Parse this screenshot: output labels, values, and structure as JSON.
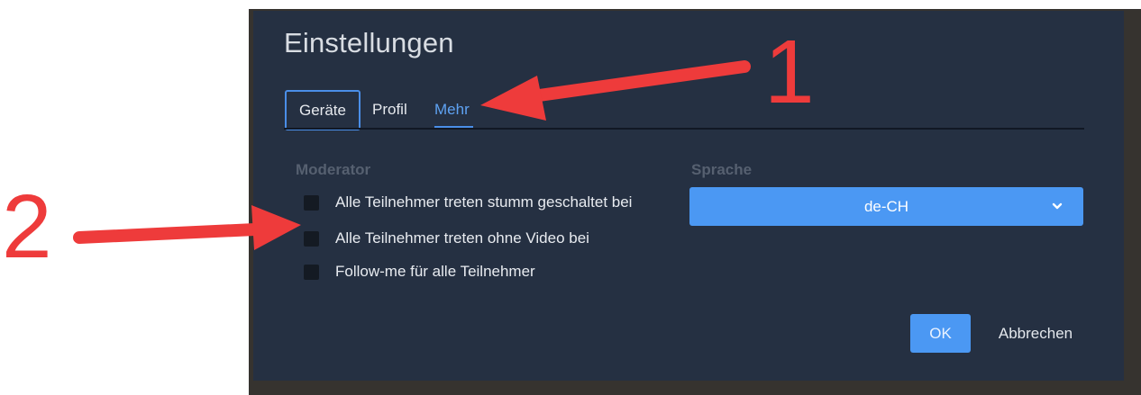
{
  "dialog": {
    "title": "Einstellungen",
    "tabs": [
      {
        "label": "Geräte",
        "state": "focused"
      },
      {
        "label": "Profil",
        "state": "default"
      },
      {
        "label": "Mehr",
        "state": "active"
      }
    ],
    "moderator": {
      "heading": "Moderator",
      "options": [
        {
          "label": "Alle Teilnehmer treten stumm geschaltet bei",
          "checked": false
        },
        {
          "label": "Alle Teilnehmer treten ohne Video bei",
          "checked": false
        },
        {
          "label": "Follow-me für alle Teilnehmer",
          "checked": false
        }
      ]
    },
    "language": {
      "heading": "Sprache",
      "selected": "de-CH"
    },
    "buttons": {
      "ok": "OK",
      "cancel": "Abbrechen"
    }
  },
  "annotations": {
    "marker_1": "1",
    "marker_2": "2",
    "color": "#ee3b3b"
  },
  "colors": {
    "dialog_bg": "#253042",
    "accent": "#4b98f3",
    "text": "#e8ebf0",
    "muted": "#566070"
  }
}
